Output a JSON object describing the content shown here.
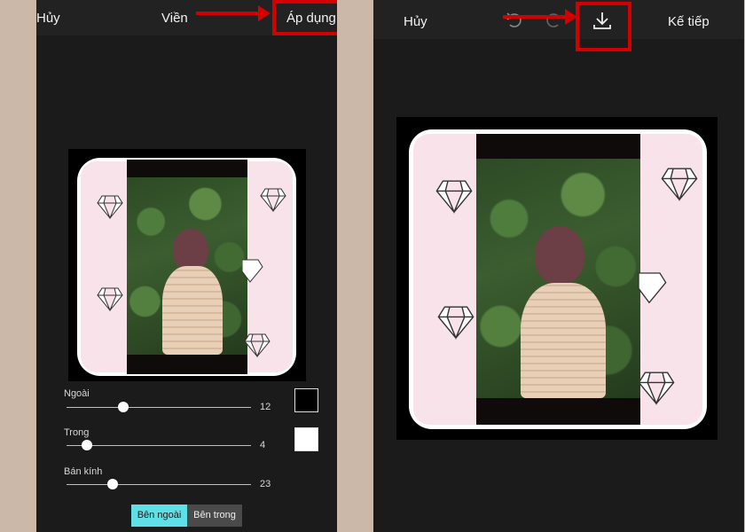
{
  "left": {
    "cancel_label": "Hủy",
    "title": "Viền",
    "apply_label": "Áp dụng",
    "sliders": [
      {
        "label": "Ngoài",
        "value": "12",
        "level": 0.32
      },
      {
        "label": "Trong",
        "value": "4",
        "level": 0.12
      },
      {
        "label": "Bán kính",
        "value": "23",
        "level": 0.26
      }
    ],
    "outer_color": "#000000",
    "inner_color": "#ffffff",
    "seg_outside": "Bên ngoài",
    "seg_inside": "Bên trong",
    "active_segment_color": "#5ee0e6"
  },
  "right": {
    "cancel_label": "Hủy",
    "next_label": "Kế tiếp",
    "icons": [
      "undo-icon",
      "redo-icon",
      "download-icon"
    ]
  },
  "highlight_color": "#d40000"
}
